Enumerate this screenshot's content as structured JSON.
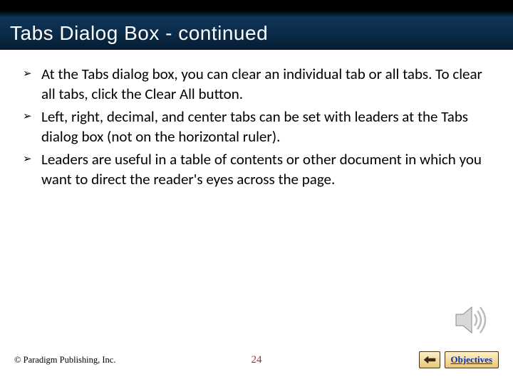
{
  "title": "Tabs Dialog Box - continued",
  "bullets": [
    "At the Tabs dialog box, you can clear an individual tab or all tabs. To clear all tabs, click the Clear All button.",
    "Left, right, decimal, and center tabs can be set with leaders at the Tabs dialog box (not on the horizontal ruler).",
    "Leaders are useful in a table of contents or other document in which you want to direct the reader's eyes across the page."
  ],
  "footer": {
    "copyright": "© Paradigm Publishing, Inc.",
    "page": "24",
    "objectives_label": "Objectives"
  }
}
